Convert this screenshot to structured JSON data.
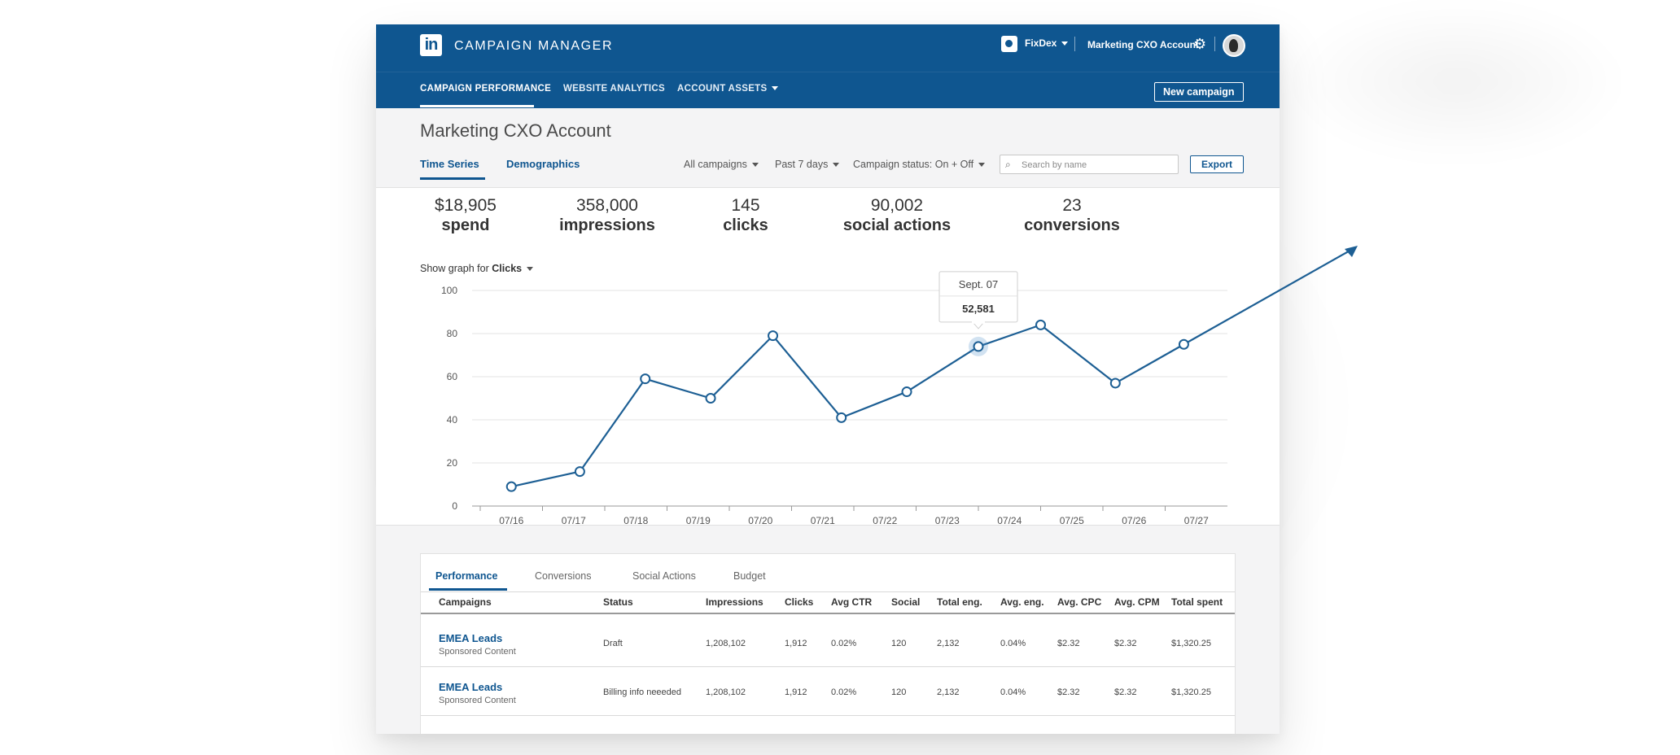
{
  "app": {
    "logo_text": "in",
    "title": "CAMPAIGN MANAGER",
    "company": "FixDex",
    "account": "Marketing CXO Account"
  },
  "nav": {
    "items": [
      "CAMPAIGN PERFORMANCE",
      "WEBSITE ANALYTICS",
      "ACCOUNT ASSETS"
    ],
    "new_campaign": "New campaign"
  },
  "page": {
    "title": "Marketing CXO Account",
    "tabs": [
      "Time Series",
      "Demographics"
    ]
  },
  "filters": {
    "campaigns": "All campaigns",
    "range": "Past 7 days",
    "status_label": "Campaign status:",
    "status_value": "On + Off",
    "search_placeholder": "Search by name",
    "export": "Export"
  },
  "metrics": [
    {
      "value": "$18,905",
      "label": "spend"
    },
    {
      "value": "358,000",
      "label": "impressions"
    },
    {
      "value": "145",
      "label": "clicks"
    },
    {
      "value": "90,002",
      "label": "social actions"
    },
    {
      "value": "23",
      "label": "conversions"
    }
  ],
  "graph_selector": {
    "prefix": "Show graph for",
    "metric": "Clicks"
  },
  "chart_data": {
    "type": "line",
    "x": [
      "07/16",
      "07/17",
      "07/18",
      "07/19",
      "07/20",
      "07/21",
      "07/22",
      "07/23",
      "07/24",
      "07/25",
      "07/26",
      "07/27"
    ],
    "point_x_index": [
      0,
      1.1,
      2.15,
      3.2,
      4.2,
      5.3,
      6.35,
      7.5,
      8.5,
      9.7,
      10.8
    ],
    "y": [
      9,
      16,
      59,
      50,
      79,
      41,
      53,
      74,
      84,
      57,
      75
    ],
    "ylim": [
      0,
      100
    ],
    "yticks": [
      0,
      20,
      40,
      60,
      80,
      100
    ],
    "highlight_index": 7,
    "tooltip": {
      "date": "Sept. 07",
      "value": "52,581"
    },
    "grid": true
  },
  "table": {
    "tabs": [
      "Performance",
      "Conversions",
      "Social Actions",
      "Budget"
    ],
    "columns": [
      "Campaigns",
      "Status",
      "Impressions",
      "Clicks",
      "Avg CTR",
      "Social",
      "Total eng.",
      "Avg. eng.",
      "Avg. CPC",
      "Avg. CPM",
      "Total spent"
    ],
    "rows": [
      {
        "name": "EMEA Leads",
        "type": "Sponsored Content",
        "status": "Draft",
        "impressions": "1,208,102",
        "clicks": "1,912",
        "ctr": "0.02%",
        "social": "120",
        "total_eng": "2,132",
        "avg_eng": "0.04%",
        "cpc": "$2.32",
        "cpm": "$2.32",
        "spent": "$1,320.25"
      },
      {
        "name": "EMEA Leads",
        "type": "Sponsored Content",
        "status": "Billing info neeeded",
        "impressions": "1,208,102",
        "clicks": "1,912",
        "ctr": "0.02%",
        "social": "120",
        "total_eng": "2,132",
        "avg_eng": "0.04%",
        "cpc": "$2.32",
        "cpm": "$2.32",
        "spent": "$1,320.25"
      }
    ]
  },
  "colors": {
    "brand": "#0f5690",
    "line": "#1d5f94"
  }
}
